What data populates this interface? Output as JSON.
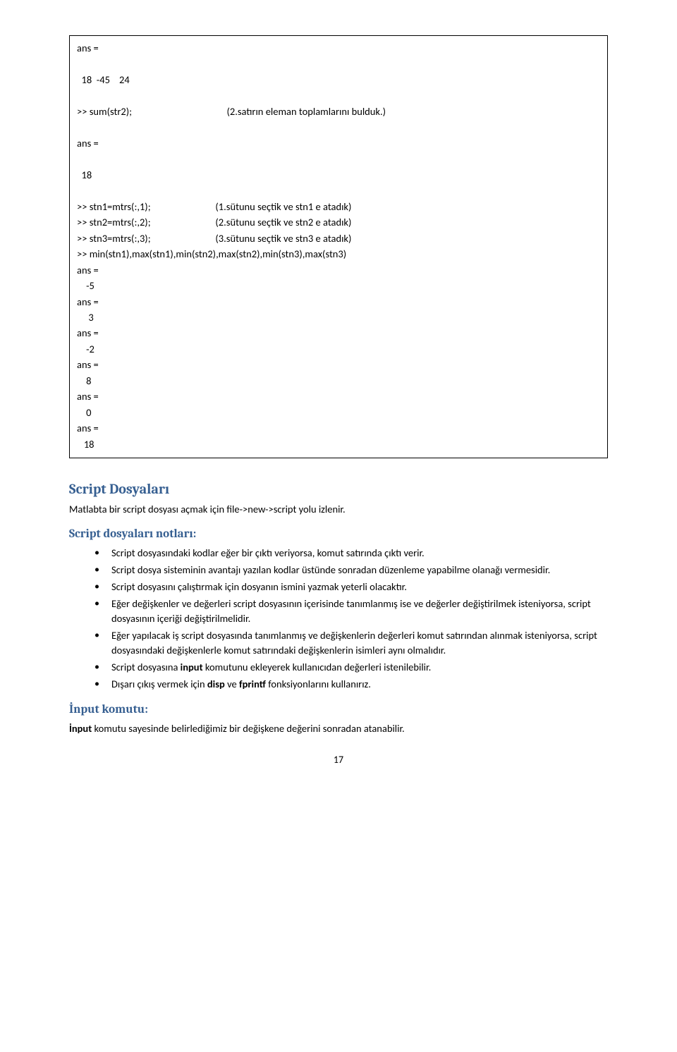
{
  "code": {
    "l1": "ans =",
    "l2": "",
    "l3": "  18  -45    24",
    "l4": "",
    "l5a": ">> sum(str2);",
    "l5b": "(2.satırın eleman toplamlarını bulduk.)",
    "l6": "",
    "l7": "ans =",
    "l8": "",
    "l9": "  18",
    "l10": "",
    "l11a": ">> stn1=mtrs(:,1);",
    "l11b": "(1.sütunu seçtik ve stn1 e atadık)",
    "l12a": ">> stn2=mtrs(:,2);",
    "l12b": "(2.sütunu seçtik ve stn2 e atadık)",
    "l13a": ">> stn3=mtrs(:,3);",
    "l13b": "(3.sütunu seçtik ve stn3 e atadık)",
    "l14": ">> min(stn1),max(stn1),min(stn2),max(stn2),min(stn3),max(stn3)",
    "l15": "ans =",
    "l16": "    -5",
    "l17": "ans =",
    "l18": "     3",
    "l19": "ans =",
    "l20": "    -2",
    "l21": "ans =",
    "l22": "    8",
    "l23": "ans =",
    "l24": "    0",
    "l25": "ans =",
    "l26": "   18"
  },
  "heading1": "Script Dosyaları",
  "para1": "Matlabta bir script dosyası açmak için file->new->script  yolu izlenir.",
  "heading2": "Script dosyaları notları:",
  "bullets": {
    "b1": "Script dosyasındaki kodlar eğer bir çıktı veriyorsa, komut satırında çıktı verir.",
    "b2": "Script dosya sisteminin avantajı yazılan kodlar üstünde sonradan düzenleme yapabilme olanağı vermesidir.",
    "b3": "Script dosyasını çalıştırmak için dosyanın ismini yazmak yeterli olacaktır.",
    "b4": "Eğer değişkenler ve değerleri script dosyasının içerisinde tanımlanmış ise ve değerler değiştirilmek isteniyorsa, script dosyasının içeriği değiştirilmelidir.",
    "b5": "Eğer yapılacak iş script dosyasında tanımlanmış ve değişkenlerin değerleri komut satırından alınmak isteniyorsa, script dosyasındaki değişkenlerle komut satırındaki değişkenlerin isimleri aynı olmalıdır.",
    "b6a": "Script dosyasına ",
    "b6b": "input",
    "b6c": " komutunu ekleyerek kullanıcıdan değerleri istenilebilir.",
    "b7a": "Dışarı çıkış vermek için ",
    "b7b": "disp",
    "b7c": " ve ",
    "b7d": "fprintf",
    "b7e": " fonksiyonlarını kullanırız."
  },
  "heading3": "İnput komutu:",
  "para2a": "İnput",
  "para2b": "  komutu sayesinde belirlediğimiz  bir değişkene değerini sonradan atanabilir.",
  "pageNumber": "17"
}
